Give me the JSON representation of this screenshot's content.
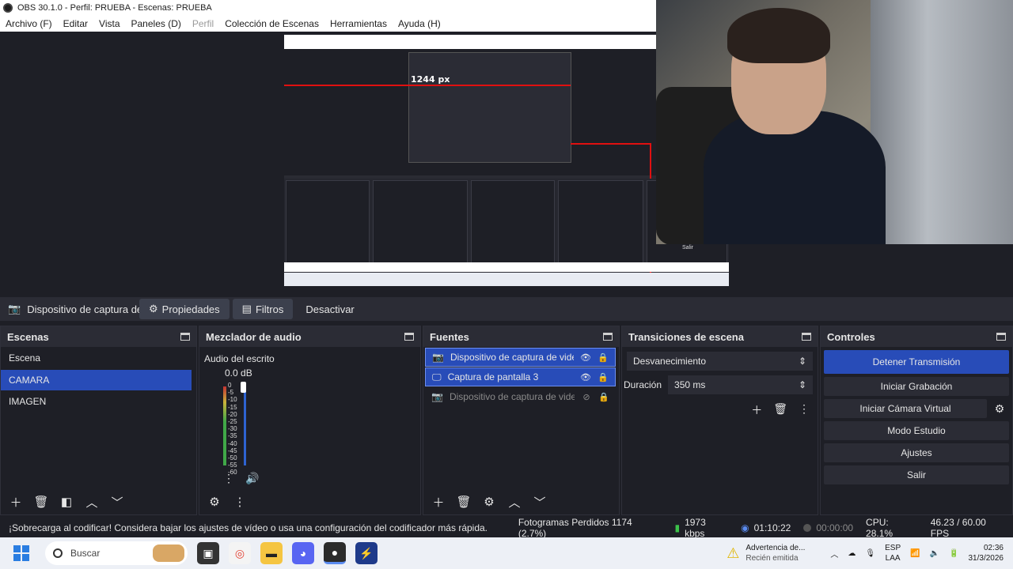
{
  "window": {
    "title": "OBS 30.1.0 - Perfil: PRUEBA - Escenas: PRUEBA"
  },
  "menu": [
    "Archivo (F)",
    "Editar",
    "Vista",
    "Paneles (D)",
    "Perfil",
    "Colección de Escenas",
    "Herramientas",
    "Ayuda (H)"
  ],
  "preview": {
    "measure_label": "1244 px",
    "inner_caption": "Salir"
  },
  "source_toolbar": {
    "source_name": "Dispositivo de captura de v",
    "properties": "Propiedades",
    "filters": "Filtros",
    "deactivate": "Desactivar"
  },
  "scenes": {
    "title": "Escenas",
    "items": [
      "Escena",
      "CAMARA",
      "IMAGEN"
    ],
    "selected": "CAMARA"
  },
  "mixer": {
    "title": "Mezclador de audio",
    "channel": "Audio del escrito",
    "db": "0.0 dB",
    "scale": [
      "0",
      "-5",
      "-10",
      "-15",
      "-20",
      "-25",
      "-30",
      "-35",
      "-40",
      "-45",
      "-50",
      "-55",
      "-60"
    ]
  },
  "sources": {
    "title": "Fuentes",
    "items": [
      {
        "name": "Dispositivo de captura de video",
        "visible": true
      },
      {
        "name": "Captura de pantalla 3",
        "visible": true
      },
      {
        "name": "Dispositivo de captura de video",
        "visible": false
      }
    ]
  },
  "transitions": {
    "title": "Transiciones de escena",
    "selected": "Desvanecimiento",
    "duration_label": "Duración",
    "duration_value": "350 ms"
  },
  "controls": {
    "title": "Controles",
    "stop_stream": "Detener Transmisión",
    "start_recording": "Iniciar Grabación",
    "start_virtual_cam": "Iniciar Cámara Virtual",
    "studio_mode": "Modo Estudio",
    "settings": "Ajustes",
    "exit": "Salir"
  },
  "status": {
    "warning": "¡Sobrecarga al codificar! Considera bajar los ajustes de vídeo o usa una configuración del codificador más rápida.",
    "dropped": "Fotogramas Perdidos 1174 (2.7%)",
    "bitrate": "1973 kbps",
    "stream_time": "01:10:22",
    "rec_time": "00:00:00",
    "cpu": "CPU: 28.1%",
    "fps": "46.23 / 60.00 FPS"
  },
  "taskbar": {
    "search_placeholder": "Buscar",
    "notif_title": "Advertencia de...",
    "notif_sub": "Recién emitida",
    "lang_top": "ESP",
    "lang_bottom": "LAA",
    "time": "02:36",
    "date": "31/3/2026"
  },
  "colors": {
    "accent": "#284cb8",
    "panel": "#1e1f26",
    "header": "#2b2c35",
    "red_guide": "#e01010"
  }
}
